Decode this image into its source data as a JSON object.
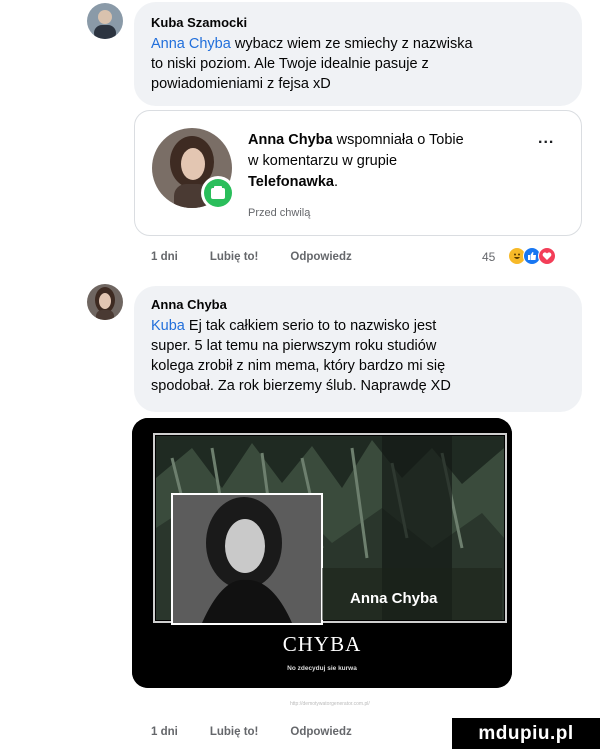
{
  "comment1": {
    "author": "Kuba Szamocki",
    "mention": "Anna Chyba",
    "text_after_mention": " wybacz wiem ze smiechy z nazwiska",
    "line2": "to niski poziom. Ale Twoje idealnie pasuje z",
    "line3": "powiadomieniami z fejsa xD"
  },
  "notification": {
    "name": "Anna Chyba",
    "text1": " wspomniała o Tobie",
    "text2": "w komentarzu w grupie",
    "group": "Telefonawka",
    "group_suffix": ".",
    "time": "Przed chwilą",
    "more": "..."
  },
  "actions1": {
    "time": "1 dni",
    "like": "Lubię to!",
    "reply": "Odpowiedz",
    "reaction_count": "45"
  },
  "comment2": {
    "author": "Anna Chyba",
    "mention": "Kuba",
    "text_after_mention": " Ej tak całkiem serio to to nazwisko jest",
    "line2": "super. 5 lat temu na pierwszym roku studiów",
    "line3": "kolega zrobił z nim mema, który bardzo mi się",
    "line4": "spodobał. Za rok bierzemy ślub. Naprawdę XD"
  },
  "meme": {
    "name_overlay": "Anna Chyba",
    "title": "CHYBA",
    "subtitle": "No zdecyduj sie kurwa",
    "watermark": "http://demotywatorgenerator.com.pl/"
  },
  "actions2": {
    "time": "1 dni",
    "like": "Lubię to!",
    "reply": "Odpowiedz"
  },
  "site_logo": "mdupiu.pl",
  "colors": {
    "mention": "#216fdb",
    "bubble": "#f0f2f5",
    "like_blue": "#1877f2",
    "haha_yellow": "#f7b928",
    "love_red": "#f33e58"
  }
}
